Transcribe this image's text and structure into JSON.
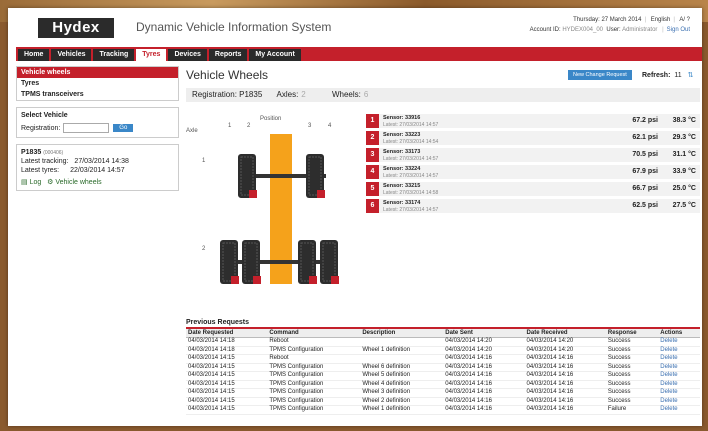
{
  "header": {
    "logo": "Hydex",
    "app_title": "Dynamic Vehicle Information System",
    "date": "Thursday: 27 March 2014",
    "language": "English",
    "account_label": "Account ID:",
    "account_value": "HYDEX004_00",
    "user_label": "User:",
    "user_value": "Administrator",
    "signout": "Sign Out"
  },
  "nav": [
    "Home",
    "Vehicles",
    "Tracking",
    "Tyres",
    "Devices",
    "Reports",
    "My Account"
  ],
  "nav_active": "Tyres",
  "sidebar": {
    "selected": "Vehicle wheels",
    "items": [
      "Tyres",
      "TPMS transceivers"
    ],
    "select_title": "Select Vehicle",
    "registration_label": "Registration:",
    "go": "Go",
    "vehicle": {
      "reg": "P1835",
      "code": "(000406)",
      "tracking_label": "Latest tracking:",
      "tracking_value": "27/03/2014 14:38",
      "tyres_label": "Latest tyres:",
      "tyres_value": "22/03/2014 14:57",
      "log": "Log",
      "wheels": "Vehicle wheels"
    }
  },
  "main": {
    "title": "Vehicle Wheels",
    "new_request": "New Change Request",
    "refresh_label": "Refresh:",
    "refresh_value": "11",
    "registration": "Registration: P1835",
    "axles_label": "Axles:",
    "axles_value": "2",
    "wheels_label": "Wheels:",
    "wheels_value": "6",
    "axle": "Axle",
    "position": "Position",
    "positions": [
      "1",
      "2",
      "3",
      "4"
    ],
    "axle_numbers": [
      "1",
      "2"
    ]
  },
  "sensors": [
    {
      "n": "1",
      "name": "Sensor: 33916",
      "latest": "Latest: 27/03/2014 14:57",
      "psi": "67.2 psi",
      "temp": "38.3 °C"
    },
    {
      "n": "2",
      "name": "Sensor: 33223",
      "latest": "Latest: 27/03/2014 14:54",
      "psi": "62.1 psi",
      "temp": "29.3 °C"
    },
    {
      "n": "3",
      "name": "Sensor: 33173",
      "latest": "Latest: 27/03/2014 14:57",
      "psi": "70.5 psi",
      "temp": "31.1 °C"
    },
    {
      "n": "4",
      "name": "Sensor: 33224",
      "latest": "Latest: 27/03/2014 14:57",
      "psi": "67.9 psi",
      "temp": "33.9 °C"
    },
    {
      "n": "5",
      "name": "Sensor: 33215",
      "latest": "Latest: 27/03/2014 14:58",
      "psi": "66.7 psi",
      "temp": "25.0 °C"
    },
    {
      "n": "6",
      "name": "Sensor: 33174",
      "latest": "Latest: 27/03/2014 14:57",
      "psi": "62.5 psi",
      "temp": "27.5 °C"
    }
  ],
  "previous": {
    "title": "Previous Requests",
    "columns": [
      "Date Requested",
      "Command",
      "Description",
      "Date Sent",
      "Date Received",
      "Response",
      "Actions"
    ],
    "rows": [
      [
        "04/03/2014 14:18",
        "Reboot",
        "",
        "04/03/2014 14:20",
        "04/03/2014 14:20",
        "Success",
        "Delete"
      ],
      [
        "04/03/2014 14:18",
        "TPMS Configuration",
        "Wheel 1 definition",
        "04/03/2014 14:20",
        "04/03/2014 14:20",
        "Success",
        "Delete"
      ],
      [
        "04/03/2014 14:15",
        "Reboot",
        "",
        "04/03/2014 14:16",
        "04/03/2014 14:16",
        "Success",
        "Delete"
      ],
      [
        "04/03/2014 14:15",
        "TPMS Configuration",
        "Wheel 6 definition",
        "04/03/2014 14:16",
        "04/03/2014 14:16",
        "Success",
        "Delete"
      ],
      [
        "04/03/2014 14:15",
        "TPMS Configuration",
        "Wheel 5 definition",
        "04/03/2014 14:16",
        "04/03/2014 14:16",
        "Success",
        "Delete"
      ],
      [
        "04/03/2014 14:15",
        "TPMS Configuration",
        "Wheel 4 definition",
        "04/03/2014 14:16",
        "04/03/2014 14:16",
        "Success",
        "Delete"
      ],
      [
        "04/03/2014 14:15",
        "TPMS Configuration",
        "Wheel 3 definition",
        "04/03/2014 14:16",
        "04/03/2014 14:16",
        "Success",
        "Delete"
      ],
      [
        "04/03/2014 14:15",
        "TPMS Configuration",
        "Wheel 2 definition",
        "04/03/2014 14:16",
        "04/03/2014 14:16",
        "Success",
        "Delete"
      ],
      [
        "04/03/2014 14:15",
        "TPMS Configuration",
        "Wheel 1 definition",
        "04/03/2014 14:16",
        "04/03/2014 14:16",
        "Failure",
        "Delete"
      ]
    ]
  },
  "colors": {
    "accent": "#c4202b",
    "dark": "#2a2a2a",
    "chassis": "#f5a21b",
    "button": "#3a87c8"
  }
}
